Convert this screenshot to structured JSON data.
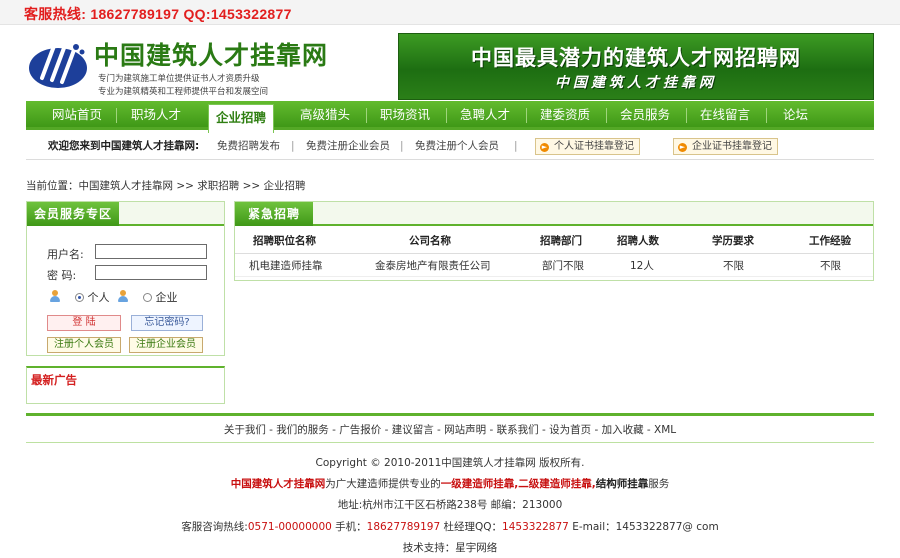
{
  "hotline": {
    "text": "客服热线: 18627789197  QQ:1453322877"
  },
  "logo": {
    "title": "中国建筑人才挂靠网",
    "slogan1": "专门为建筑施工单位提供证书人才资质升级",
    "slogan2": "专业为建筑精英和工程师提供平台和发展空间"
  },
  "banner": {
    "line1": "中国最具潜力的建筑人才网招聘网",
    "line2": "中国建筑人才挂靠网"
  },
  "nav": {
    "items": [
      "网站首页",
      "职场人才",
      "企业招聘",
      "高级猎头",
      "职场资讯",
      "急聘人才",
      "建委资质",
      "会员服务",
      "在线留言",
      "论坛"
    ],
    "active_index": 2
  },
  "subbar": {
    "welcome": "欢迎您来到中国建筑人才挂靠网:",
    "links": [
      "免费招聘发布",
      "免费注册企业会员",
      "免费注册个人会员"
    ],
    "pipe": "|",
    "button1": "个人证书挂靠登记",
    "button2": "企业证书挂靠登记"
  },
  "breadcrumb": "当前位置：中国建筑人才挂靠网 >> 求职招聘 >> 企业招聘",
  "member": {
    "title": "会员服务专区",
    "username_label": "用户名:",
    "password_label": "密  码:",
    "username_value": "",
    "password_value": "",
    "radio_personal": "个人",
    "radio_company": "企业",
    "login_button": "登  陆",
    "forgot_button": "忘记密码?",
    "register_personal": "注册个人会员",
    "register_company": "注册企业会员"
  },
  "ads": {
    "title": "最新广告"
  },
  "urgent": {
    "title": "紧急招聘",
    "headers": [
      "招聘职位名称",
      "公司名称",
      "招聘部门",
      "招聘人数",
      "学历要求",
      "工作经验"
    ],
    "rows": [
      [
        "机电建造师挂靠",
        "金泰房地产有限责任公司",
        "部门不限",
        "12人",
        "不限",
        "不限"
      ]
    ]
  },
  "footer": {
    "nav": "关于我们 - 我们的服务 - 广告报价 - 建议留言 - 网站声明 - 联系我们 - 设为首页 - 加入收藏 - XML",
    "copyright": "Copyright © 2010-2011中国建筑人才挂靠网 版权所有.",
    "intro_site": "中国建筑人才挂靠网",
    "intro_mid": "为广大建造师提供专业的",
    "intro_hl": "一级建造师挂靠,二级建造师挂靠,",
    "intro_b": "结构师挂靠",
    "intro_end": "服务",
    "address": "地址:杭州市江干区石桥路238号 邮编：213000",
    "c_label1": "客服咨询热线:",
    "c_tel": "0571-00000000",
    "c_label2": " 手机：",
    "c_mobile": "18627789197",
    "c_label3": " 杜经理QQ：",
    "c_qq": "1453322877",
    "c_email": " E-mail：1453322877@ com",
    "support": "技术支持：星宇网络"
  },
  "colors": {
    "accent": "#4fa61f",
    "hotline": "#e21e1e",
    "highlight": "#c81010"
  }
}
